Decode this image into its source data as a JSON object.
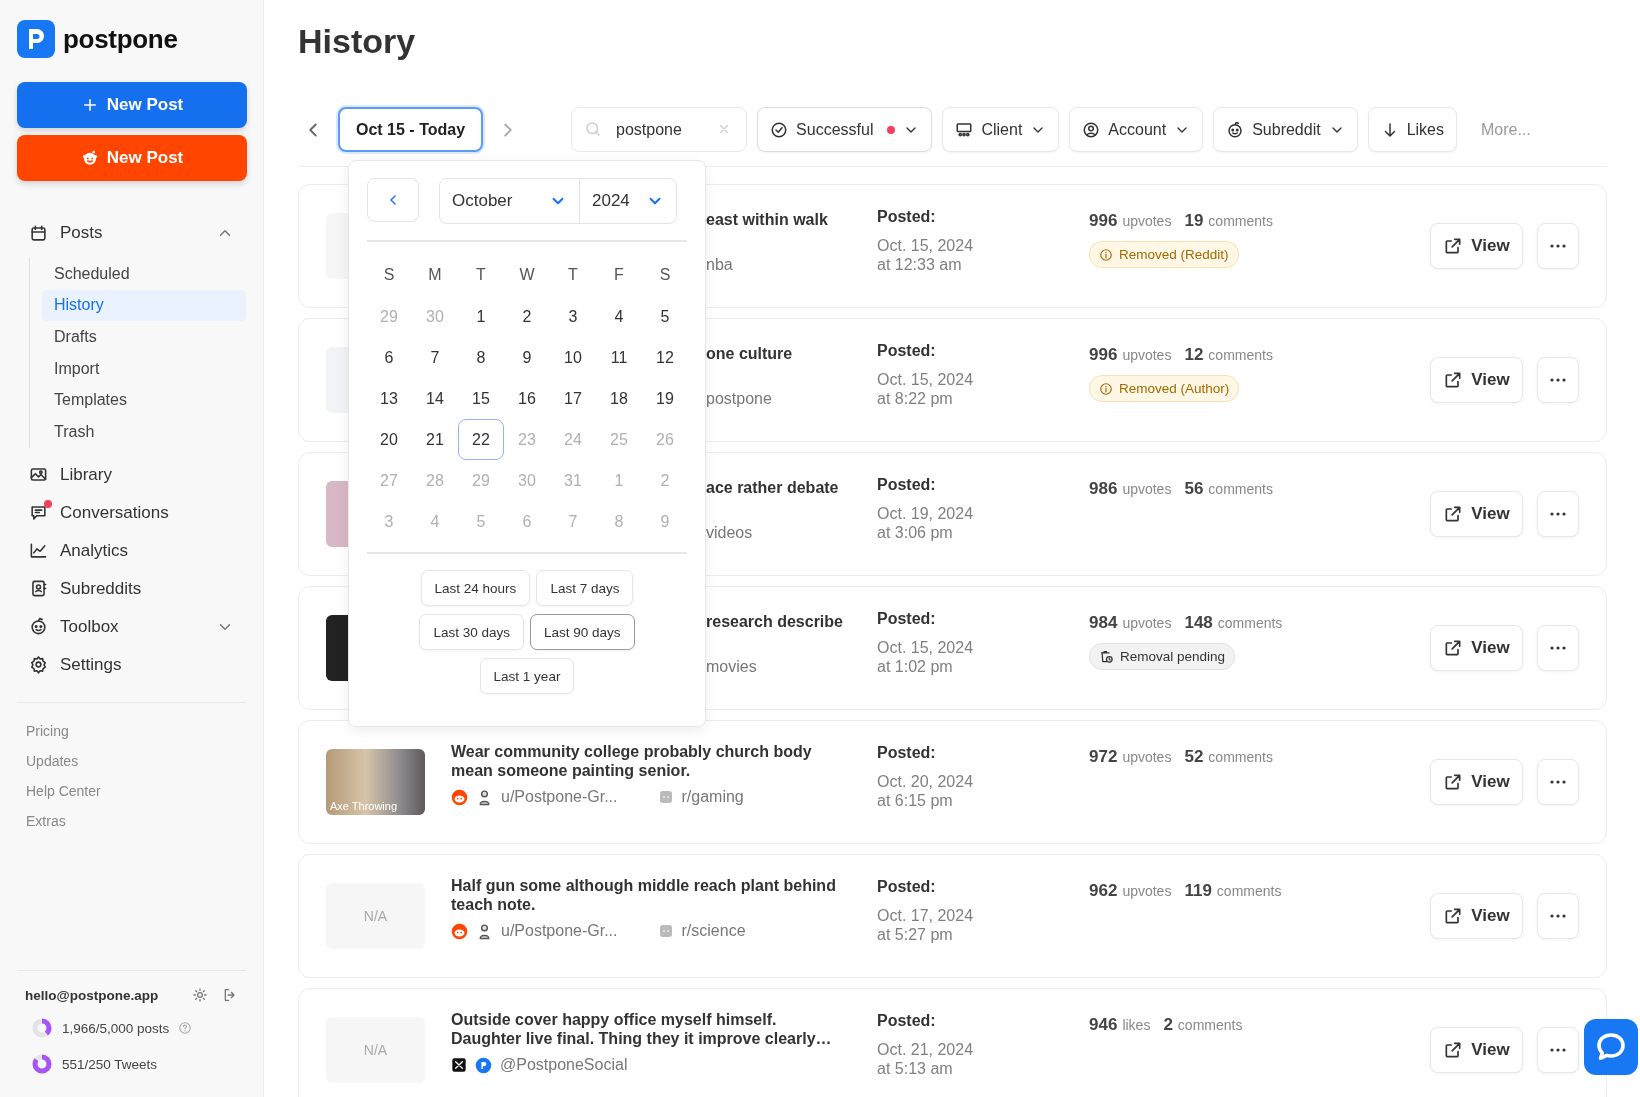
{
  "app": {
    "name": "postpone"
  },
  "sidebar": {
    "buttons": [
      {
        "kind": "plain",
        "label": "New Post"
      },
      {
        "kind": "reddit",
        "label": "New Post"
      }
    ],
    "nav": [
      {
        "label": "Posts",
        "expanded": true,
        "unread": false,
        "children": [
          {
            "label": "Scheduled",
            "selected": false
          },
          {
            "label": "History",
            "selected": true
          },
          {
            "label": "Drafts",
            "selected": false
          },
          {
            "label": "Import",
            "selected": false
          },
          {
            "label": "Templates",
            "selected": false
          },
          {
            "label": "Trash",
            "selected": false
          }
        ]
      },
      {
        "label": "Library",
        "unread": false
      },
      {
        "label": "Conversations",
        "unread": true
      },
      {
        "label": "Analytics",
        "unread": false
      },
      {
        "label": "Subreddits",
        "unread": false
      },
      {
        "label": "Toolbox",
        "expanded": false,
        "unread": false
      },
      {
        "label": "Settings",
        "unread": false
      }
    ],
    "links": [
      "Pricing",
      "Updates",
      "Help Center",
      "Extras"
    ],
    "account": {
      "email": "hello@postpone.app"
    },
    "usage": [
      {
        "label": "1,966/5,000 posts",
        "level": 0.39,
        "help": true
      },
      {
        "label": "551/250 Tweets",
        "level": 0.85,
        "help": false
      }
    ]
  },
  "page": {
    "title": "History"
  },
  "filters": {
    "date_range": {
      "label": "Oct 15 - Today",
      "open": true
    },
    "search": {
      "value": "postpone"
    },
    "chips": [
      {
        "label": "Successful",
        "active": true,
        "dropdown": true
      },
      {
        "label": "Client",
        "active": false,
        "dropdown": true
      },
      {
        "label": "Account",
        "active": false,
        "dropdown": true
      },
      {
        "label": "Subreddit",
        "active": false,
        "dropdown": true
      },
      {
        "label": "Likes",
        "active": false,
        "dropdown": false
      }
    ],
    "more": "More..."
  },
  "date_picker": {
    "month": "October",
    "year": "2024",
    "weekdays": [
      "S",
      "M",
      "T",
      "W",
      "T",
      "F",
      "S"
    ],
    "weeks": [
      [
        {
          "day": "29",
          "muted": true,
          "selected": false
        },
        {
          "day": "30",
          "muted": true,
          "selected": false
        },
        {
          "day": "1",
          "muted": false,
          "selected": false
        },
        {
          "day": "2",
          "muted": false,
          "selected": false
        },
        {
          "day": "3",
          "muted": false,
          "selected": false
        },
        {
          "day": "4",
          "muted": false,
          "selected": false
        },
        {
          "day": "5",
          "muted": false,
          "selected": false
        }
      ],
      [
        {
          "day": "6",
          "muted": false,
          "selected": false
        },
        {
          "day": "7",
          "muted": false,
          "selected": false
        },
        {
          "day": "8",
          "muted": false,
          "selected": false
        },
        {
          "day": "9",
          "muted": false,
          "selected": false
        },
        {
          "day": "10",
          "muted": false,
          "selected": false
        },
        {
          "day": "11",
          "muted": false,
          "selected": false
        },
        {
          "day": "12",
          "muted": false,
          "selected": false
        }
      ],
      [
        {
          "day": "13",
          "muted": false,
          "selected": false
        },
        {
          "day": "14",
          "muted": false,
          "selected": false
        },
        {
          "day": "15",
          "muted": false,
          "selected": false
        },
        {
          "day": "16",
          "muted": false,
          "selected": false
        },
        {
          "day": "17",
          "muted": false,
          "selected": false
        },
        {
          "day": "18",
          "muted": false,
          "selected": false
        },
        {
          "day": "19",
          "muted": false,
          "selected": false
        }
      ],
      [
        {
          "day": "20",
          "muted": false,
          "selected": false
        },
        {
          "day": "21",
          "muted": false,
          "selected": false
        },
        {
          "day": "22",
          "muted": false,
          "selected": true
        },
        {
          "day": "23",
          "muted": true,
          "selected": false
        },
        {
          "day": "24",
          "muted": true,
          "selected": false
        },
        {
          "day": "25",
          "muted": true,
          "selected": false
        },
        {
          "day": "26",
          "muted": true,
          "selected": false
        }
      ],
      [
        {
          "day": "27",
          "muted": true,
          "selected": false
        },
        {
          "day": "28",
          "muted": true,
          "selected": false
        },
        {
          "day": "29",
          "muted": true,
          "selected": false
        },
        {
          "day": "30",
          "muted": true,
          "selected": false
        },
        {
          "day": "31",
          "muted": true,
          "selected": false
        },
        {
          "day": "1",
          "muted": true,
          "selected": false
        },
        {
          "day": "2",
          "muted": true,
          "selected": false
        }
      ],
      [
        {
          "day": "3",
          "muted": true,
          "selected": false
        },
        {
          "day": "4",
          "muted": true,
          "selected": false
        },
        {
          "day": "5",
          "muted": true,
          "selected": false
        },
        {
          "day": "6",
          "muted": true,
          "selected": false
        },
        {
          "day": "7",
          "muted": true,
          "selected": false
        },
        {
          "day": "8",
          "muted": true,
          "selected": false
        },
        {
          "day": "9",
          "muted": true,
          "selected": false
        }
      ]
    ],
    "ranges": [
      [
        {
          "label": "Last 24 hours",
          "selected": false
        },
        {
          "label": "Last 7 days",
          "selected": false
        }
      ],
      [
        {
          "label": "Last 30 days",
          "selected": false
        },
        {
          "label": "Last 90 days",
          "selected": true
        }
      ],
      [
        {
          "label": "Last 1 year",
          "selected": false
        }
      ]
    ]
  },
  "posts": [
    {
      "partial": true,
      "thumbnail": {
        "kind": "blank"
      },
      "title": "east within walk",
      "subreddit": "nba",
      "posted": "Posted:",
      "date": "Oct. 15, 2024",
      "time": "at 12:33 am",
      "score": "996",
      "score_unit": "upvotes",
      "comments": "19",
      "comments_unit": "comments",
      "badge": {
        "kind": "warning",
        "label": "Removed (Reddit)"
      },
      "view": "View"
    },
    {
      "partial": true,
      "thumbnail": {
        "kind": "screenshot"
      },
      "title": "one culture",
      "subreddit": "postpone",
      "posted": "Posted:",
      "date": "Oct. 15, 2024",
      "time": "at 8:22 pm",
      "score": "996",
      "score_unit": "upvotes",
      "comments": "12",
      "comments_unit": "comments",
      "badge": {
        "kind": "warning",
        "label": "Removed (Author)"
      },
      "view": "View"
    },
    {
      "partial": true,
      "thumbnail": {
        "kind": "pink"
      },
      "title": "ace rather debate",
      "subreddit": "videos",
      "posted": "Posted:",
      "date": "Oct. 19, 2024",
      "time": "at 3:06 pm",
      "score": "986",
      "score_unit": "upvotes",
      "comments": "56",
      "comments_unit": "comments",
      "view": "View"
    },
    {
      "partial": true,
      "thumbnail": {
        "kind": "dark"
      },
      "title": "research describe",
      "subreddit": "movies",
      "posted": "Posted:",
      "date": "Oct. 15, 2024",
      "time": "at 1:02 pm",
      "score": "984",
      "score_unit": "upvotes",
      "comments": "148",
      "comments_unit": "comments",
      "badge": {
        "kind": "pending",
        "label": "Removal pending"
      },
      "view": "View"
    },
    {
      "partial": false,
      "thumbnail": {
        "kind": "photo",
        "caption": "Axe Throwing"
      },
      "title": "Wear community college probably church body mean someone painting senior.",
      "kind": "reddit",
      "account": "u/Postpone-Gr...",
      "subreddit": "r/gaming",
      "posted": "Posted:",
      "date": "Oct. 20, 2024",
      "time": "at 6:15 pm",
      "score": "972",
      "score_unit": "upvotes",
      "comments": "52",
      "comments_unit": "comments",
      "view": "View"
    },
    {
      "partial": false,
      "thumbnail": {
        "kind": "none",
        "caption": "N/A"
      },
      "title": "Half gun some although middle reach plant behind teach note.",
      "kind": "reddit",
      "account": "u/Postpone-Gr...",
      "subreddit": "r/science",
      "posted": "Posted:",
      "date": "Oct. 17, 2024",
      "time": "at 5:27 pm",
      "score": "962",
      "score_unit": "upvotes",
      "comments": "119",
      "comments_unit": "comments",
      "view": "View"
    },
    {
      "partial": false,
      "thumbnail": {
        "kind": "none",
        "caption": "N/A"
      },
      "title": "Outside cover happy office myself himself. Daughter live final. Thing they it improve clearly…",
      "kind": "x",
      "account": "@PostponeSocial",
      "posted": "Posted:",
      "date": "Oct. 21, 2024",
      "time": "at 5:13 am",
      "score": "946",
      "score_unit": "likes",
      "comments": "2",
      "comments_unit": "comments",
      "view": "View"
    }
  ]
}
